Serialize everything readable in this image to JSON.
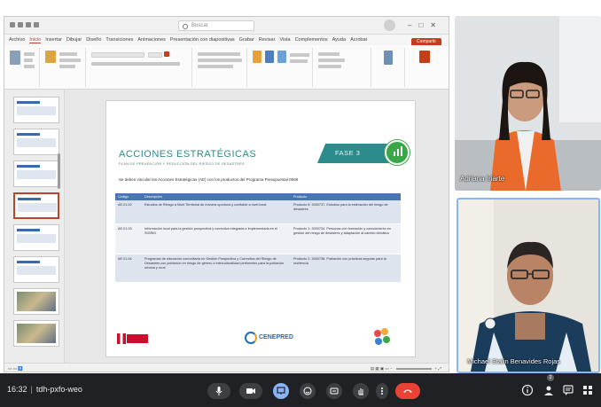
{
  "app": {
    "search_placeholder": "Buscar"
  },
  "menu": {
    "tabs": [
      "Archivo",
      "Inicio",
      "Insertar",
      "Dibujar",
      "Diseño",
      "Transiciones",
      "Animaciones",
      "Presentación con diapositivas",
      "Grabar",
      "Revisar",
      "Vista",
      "Complementos",
      "Ayuda",
      "Acrobat"
    ],
    "active_index": 1,
    "share_label": "Compartir"
  },
  "slide": {
    "title": "ACCIONES ESTRATÉGICAS",
    "subtitle": "PLAN DE PREVENCIÓN Y REDUCCIÓN DEL RIESGO DE DESASTRES",
    "phase_label": "FASE 3",
    "intro": "Se deben vincular las Acciones Estratégicas (AE) con los productos del Programa Presupuestal 0068",
    "table": {
      "headers": [
        "Código",
        "Descripción",
        "Producto"
      ],
      "rows": [
        [
          "AE.01.02",
          "Estudios de Riesgo a Nivel Territorial de manera oportuna y confiable a nivel local",
          "Producto 6: 3000737. Estudios para la estimación del riesgo de desastres"
        ],
        [
          "AE.01.03",
          "Información local para la gestión prospectiva y correctiva integrada e implementada en el SIGRID",
          "Producto 1: 3000734. Personas con formación y conocimiento en gestión del riesgo de desastres y adaptación al cambio climático"
        ],
        [
          "AE.01.04",
          "Programas de educación comunitaria en Gestión Prospectiva y Correctiva del Riesgo de Desastres con población en riesgo de género e interculturalidad pertinentes para la población urbana y rural",
          "Producto 2: 3000738. Población con prácticas seguras para la resiliencia"
        ]
      ]
    },
    "footer_logo": "CENEPRED"
  },
  "participants": [
    {
      "name": "Adriana Iriarte"
    },
    {
      "name": "Michael Stalin Benavides Rojas"
    }
  ],
  "meeting": {
    "time": "16:32",
    "code": "tdh-pxfo-weo",
    "participant_count": "2"
  }
}
